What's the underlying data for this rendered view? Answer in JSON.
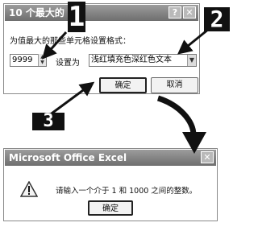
{
  "dialog1": {
    "title": "10 个最大的",
    "help_glyph": "?",
    "close_glyph": "✕",
    "instruction": "为值最大的那些单元格设置格式：",
    "count_value": "9999",
    "set_as_label": "设置为",
    "format_value": "浅红填充色深红色文本",
    "ok_label": "确定",
    "cancel_label": "取消"
  },
  "dialog2": {
    "title": "Microsoft Office Excel",
    "close_glyph": "✕",
    "message": "请输入一个介于 1 和 1000 之间的整数。",
    "ok_label": "确定"
  },
  "annotations": {
    "step1": "1",
    "step2": "2",
    "step3": "3"
  },
  "colors": {
    "titlebar": "#808080",
    "callout": "#111111"
  }
}
